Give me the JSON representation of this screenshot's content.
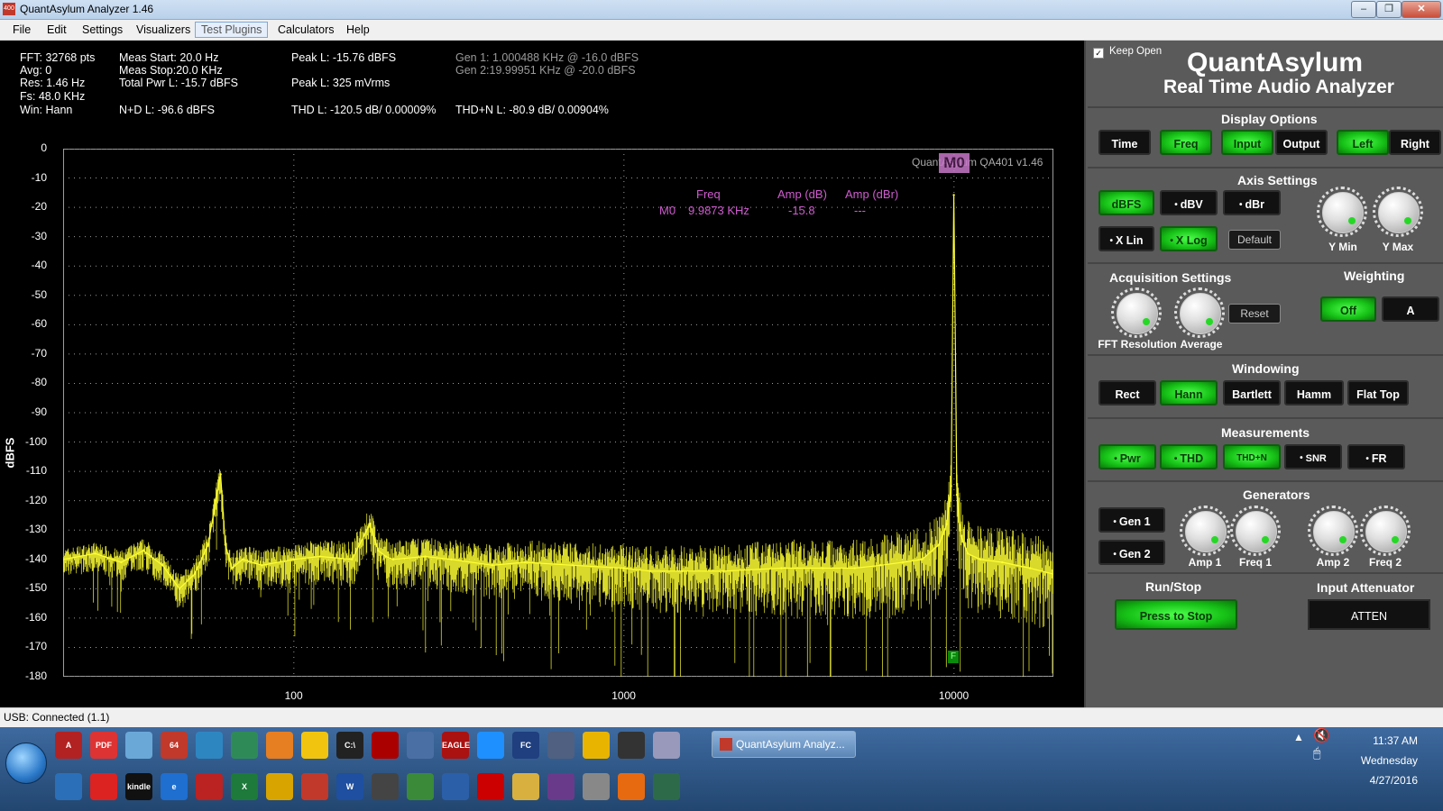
{
  "window": {
    "title": "QuantAsylum Analyzer 1.46",
    "icon_text": "400"
  },
  "menu": [
    "File",
    "Edit",
    "Settings",
    "Visualizers",
    "Test Plugins",
    "Calculators",
    "Help"
  ],
  "stats": {
    "col1": [
      "FFT: 32768 pts",
      "Avg: 0",
      "Res: 1.46 Hz",
      "Fs: 48.0 KHz",
      "Win: Hann"
    ],
    "col2": [
      "Meas Start: 20.0 Hz",
      "Meas Stop:20.0 KHz",
      "Total Pwr L: -15.7 dBFS",
      "N+D L: -96.6 dBFS"
    ],
    "peak_db": "Peak L: -15.76 dBFS",
    "peak_mv": "Peak L: 325 mVrms",
    "thd": "THD L: -120.5 dB/ 0.00009%",
    "thdn": "THD+N L: -80.9 dB/ 0.00904%",
    "gen1": "Gen 1: 1.000488 KHz @ -16.0  dBFS",
    "gen2": "Gen 2:19.99951 KHz @ -20.0  dBFS"
  },
  "marker": {
    "headers": [
      "Freq",
      "Amp (dB)",
      "Amp (dBr)"
    ],
    "name": "M0",
    "freq": "9.9873 KHz",
    "amp_db": "-15.8",
    "amp_dbr": "---",
    "box_label": "M0",
    "f_marker": "F"
  },
  "watermark": "QuantAsylum QA401 v1.46",
  "chart_data": {
    "type": "line",
    "ylabel": "dBFS",
    "xlabel": "",
    "x_scale": "log",
    "xlim": [
      20,
      20000
    ],
    "ylim": [
      -180,
      0
    ],
    "yticks": [
      "0",
      "-10",
      "-20",
      "-30",
      "-40",
      "-50",
      "-60",
      "-70",
      "-80",
      "-90",
      "-100",
      "-110",
      "-120",
      "-130",
      "-140",
      "-150",
      "-160",
      "-170",
      "-180"
    ],
    "xticks": [
      "100",
      "1000",
      "10000"
    ],
    "grid": true,
    "series": [
      {
        "color": "#ffff33",
        "x": [
          20,
          25,
          30,
          35,
          40,
          45,
          50,
          55,
          58,
          60,
          62,
          65,
          70,
          80,
          100,
          120,
          150,
          170,
          180,
          190,
          200,
          250,
          300,
          400,
          500,
          700,
          1000,
          1200,
          1500,
          2000,
          3000,
          4000,
          5000,
          6000,
          7000,
          8000,
          9000,
          9500,
          9800,
          9987,
          10200,
          10500,
          11000,
          12000,
          14000,
          17000,
          20000
        ],
        "y": [
          -140,
          -138,
          -141,
          -137,
          -142,
          -150,
          -145,
          -135,
          -120,
          -111,
          -135,
          -143,
          -140,
          -142,
          -140,
          -139,
          -140,
          -128,
          -137,
          -139,
          -140,
          -139,
          -140,
          -142,
          -141,
          -142,
          -143,
          -144,
          -144,
          -144,
          -143,
          -143,
          -143,
          -142,
          -141,
          -140,
          -135,
          -128,
          -115,
          -15.8,
          -118,
          -132,
          -138,
          -140,
          -141,
          -143,
          -145
        ]
      }
    ]
  },
  "status": "USB: Connected  (1.1)",
  "panel": {
    "keep_open": "Keep Open",
    "brand": "QuantAsylum",
    "subtitle": "Real Time Audio Analyzer",
    "display_title": "Display Options",
    "display_buttons": [
      "Time",
      "Freq",
      "Input",
      "Output",
      "Left",
      "Right"
    ],
    "axis_title": "Axis Settings",
    "axis_buttons": [
      "dBFS",
      "dBV",
      "dBr",
      "X Lin",
      "X Log"
    ],
    "default_btn": "Default",
    "ymin": "Y Min",
    "ymax": "Y Max",
    "acq_title": "Acquisition Settings",
    "fft_res": "FFT Resolution",
    "average": "Average",
    "reset": "Reset",
    "weight_title": "Weighting",
    "weight_buttons": [
      "Off",
      "A"
    ],
    "window_title": "Windowing",
    "window_buttons": [
      "Rect",
      "Hann",
      "Bartlett",
      "Hamm",
      "Flat Top"
    ],
    "meas_title": "Measurements",
    "meas_buttons": [
      "Pwr",
      "THD",
      "THD+N",
      "SNR",
      "FR"
    ],
    "gen_title": "Generators",
    "gen_buttons": [
      "Gen 1",
      "Gen 2"
    ],
    "gen_knobs": [
      "Amp 1",
      "Freq 1",
      "Amp 2",
      "Freq 2"
    ],
    "run_title": "Run/Stop",
    "run_button": "Press to Stop",
    "atten_title": "Input Attenuator",
    "atten_button": "ATTEN"
  },
  "taskbar": {
    "app_button": "QuantAsylum Analyz...",
    "time": "11:37 AM",
    "day": "Wednesday",
    "date": "4/27/2016",
    "icon_row1": [
      "acrobat-icon",
      "pdf-icon",
      "network-icon",
      "64-icon",
      "tool-icon",
      "chart-icon",
      "rocket-icon",
      "duck-icon",
      "terminal-icon",
      "record-icon",
      "notes-icon",
      "eagle-icon",
      "arrow-icon",
      "fc-icon",
      "doc-icon",
      "chrome-icon",
      "box-icon",
      "calc-icon"
    ],
    "icon_row1_text": [
      "A",
      "PDF",
      "",
      "64",
      "",
      "",
      "",
      "",
      "C:\\",
      "",
      "",
      "EAGLE",
      "",
      "FC",
      "",
      "",
      "",
      ""
    ],
    "icon_row2": [
      "bluetooth-icon",
      "splat-icon",
      "kindle-icon",
      "ie-icon",
      "lt-icon",
      "excel-icon",
      "mail-icon",
      "ppt-icon",
      "word-icon",
      "sheet-icon",
      "game-icon",
      "pc-icon",
      "stop-icon",
      "folder-icon",
      "winrar-icon",
      "camera-icon",
      "firefox-icon",
      "wave-icon"
    ],
    "icon_row2_text": [
      "",
      "",
      "kindle",
      "e",
      "",
      "X",
      "",
      "",
      "W",
      "",
      "",
      "",
      "",
      "",
      "",
      "",
      "",
      ""
    ]
  }
}
